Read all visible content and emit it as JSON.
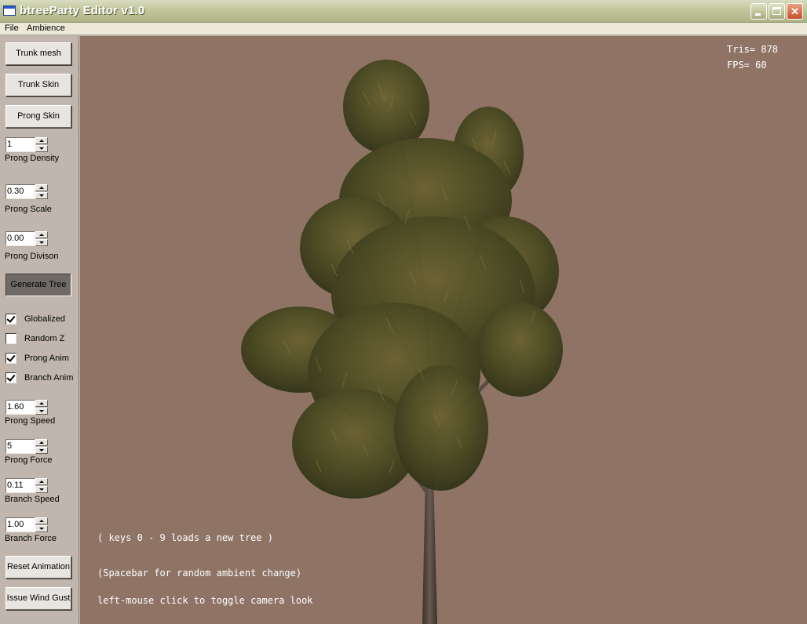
{
  "window": {
    "title": "btreeParty Editor v1.0",
    "minimize_icon": "minimize-icon",
    "maximize_icon": "maximize-icon",
    "close_glyph": "✕"
  },
  "menu": {
    "items": [
      "File",
      "Ambience"
    ]
  },
  "panel": {
    "trunk_mesh": "Trunk mesh",
    "trunk_skin": "Trunk Skin",
    "prong_skin": "Prong Skin",
    "prong_density": {
      "value": "1",
      "label": "Prong Density"
    },
    "prong_scale": {
      "value": "0.30",
      "label": "Prong Scale"
    },
    "prong_division": {
      "value": "0.00",
      "label": "Prong Divison"
    },
    "generate_tree": "Generate Tree",
    "checkboxes": [
      {
        "label": "Globalized",
        "checked": true
      },
      {
        "label": "Random Z",
        "checked": false
      },
      {
        "label": "Prong Anim",
        "checked": true
      },
      {
        "label": "Branch Anim",
        "checked": true
      }
    ],
    "prong_speed": {
      "value": "1.60",
      "label": "Prong Speed"
    },
    "prong_force": {
      "value": "5",
      "label": "Prong Force"
    },
    "branch_speed": {
      "value": "0.11",
      "label": "Branch Speed"
    },
    "branch_force": {
      "value": "1.00",
      "label": "Branch Force"
    },
    "reset_animation": "Reset Animation",
    "issue_wind_gust": "Issue Wind Gust"
  },
  "viewport": {
    "background": "#8f7466",
    "tris": "Tris= 878",
    "fps": "FPS= 60",
    "hint_keys": "( keys 0 - 9 loads a new tree )",
    "hint_space": "(Spacebar for random ambient change)",
    "hint_mouse": "left-mouse click to toggle camera look",
    "tree_icon": "tree-render",
    "foliage_color": "#4a4a22",
    "trunk_color": "#5a4a42"
  }
}
